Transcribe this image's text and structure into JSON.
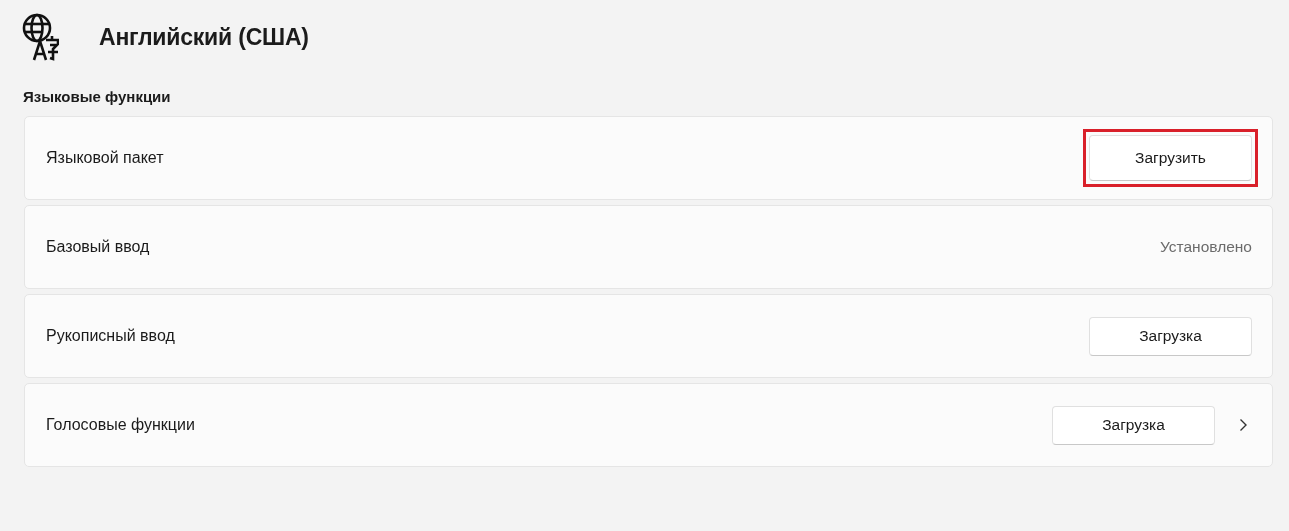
{
  "header": {
    "title": "Английский (США)"
  },
  "section": {
    "title": "Языковые функции"
  },
  "rows": [
    {
      "kind": "button",
      "label": "Языковой пакет",
      "action": "Загрузить",
      "highlighted": true,
      "chevron": false
    },
    {
      "kind": "status",
      "label": "Базовый ввод",
      "action": "Установлено",
      "highlighted": false,
      "chevron": false
    },
    {
      "kind": "button",
      "label": "Рукописный ввод",
      "action": "Загрузка",
      "highlighted": false,
      "chevron": false
    },
    {
      "kind": "button",
      "label": "Голосовые функции",
      "action": "Загрузка",
      "highlighted": false,
      "chevron": true
    }
  ]
}
